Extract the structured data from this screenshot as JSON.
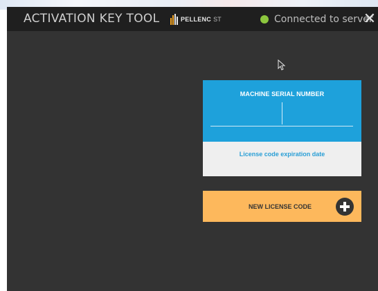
{
  "titlebar": {
    "app_title": "ACTIVATION KEY TOOL",
    "logo_bold": "PELLENC",
    "logo_light": "ST",
    "status_text": "Connected to server",
    "close_glyph": "✕"
  },
  "card": {
    "serial_label": "MACHINE SERIAL NUMBER",
    "serial_value": "",
    "expiry_label": "License code expiration date"
  },
  "new_license": {
    "label": "NEW LICENSE CODE"
  },
  "colors": {
    "titlebar_bg": "#1f1f1f",
    "window_bg": "#333333",
    "card_accent": "#1ea1db",
    "status_connected": "#8cc63e",
    "button_orange": "#fdb85c"
  },
  "icons": [
    "pellenc-logo-icon",
    "status-connected-icon",
    "close-icon",
    "mouse-cursor-icon",
    "plus-circle-icon"
  ]
}
